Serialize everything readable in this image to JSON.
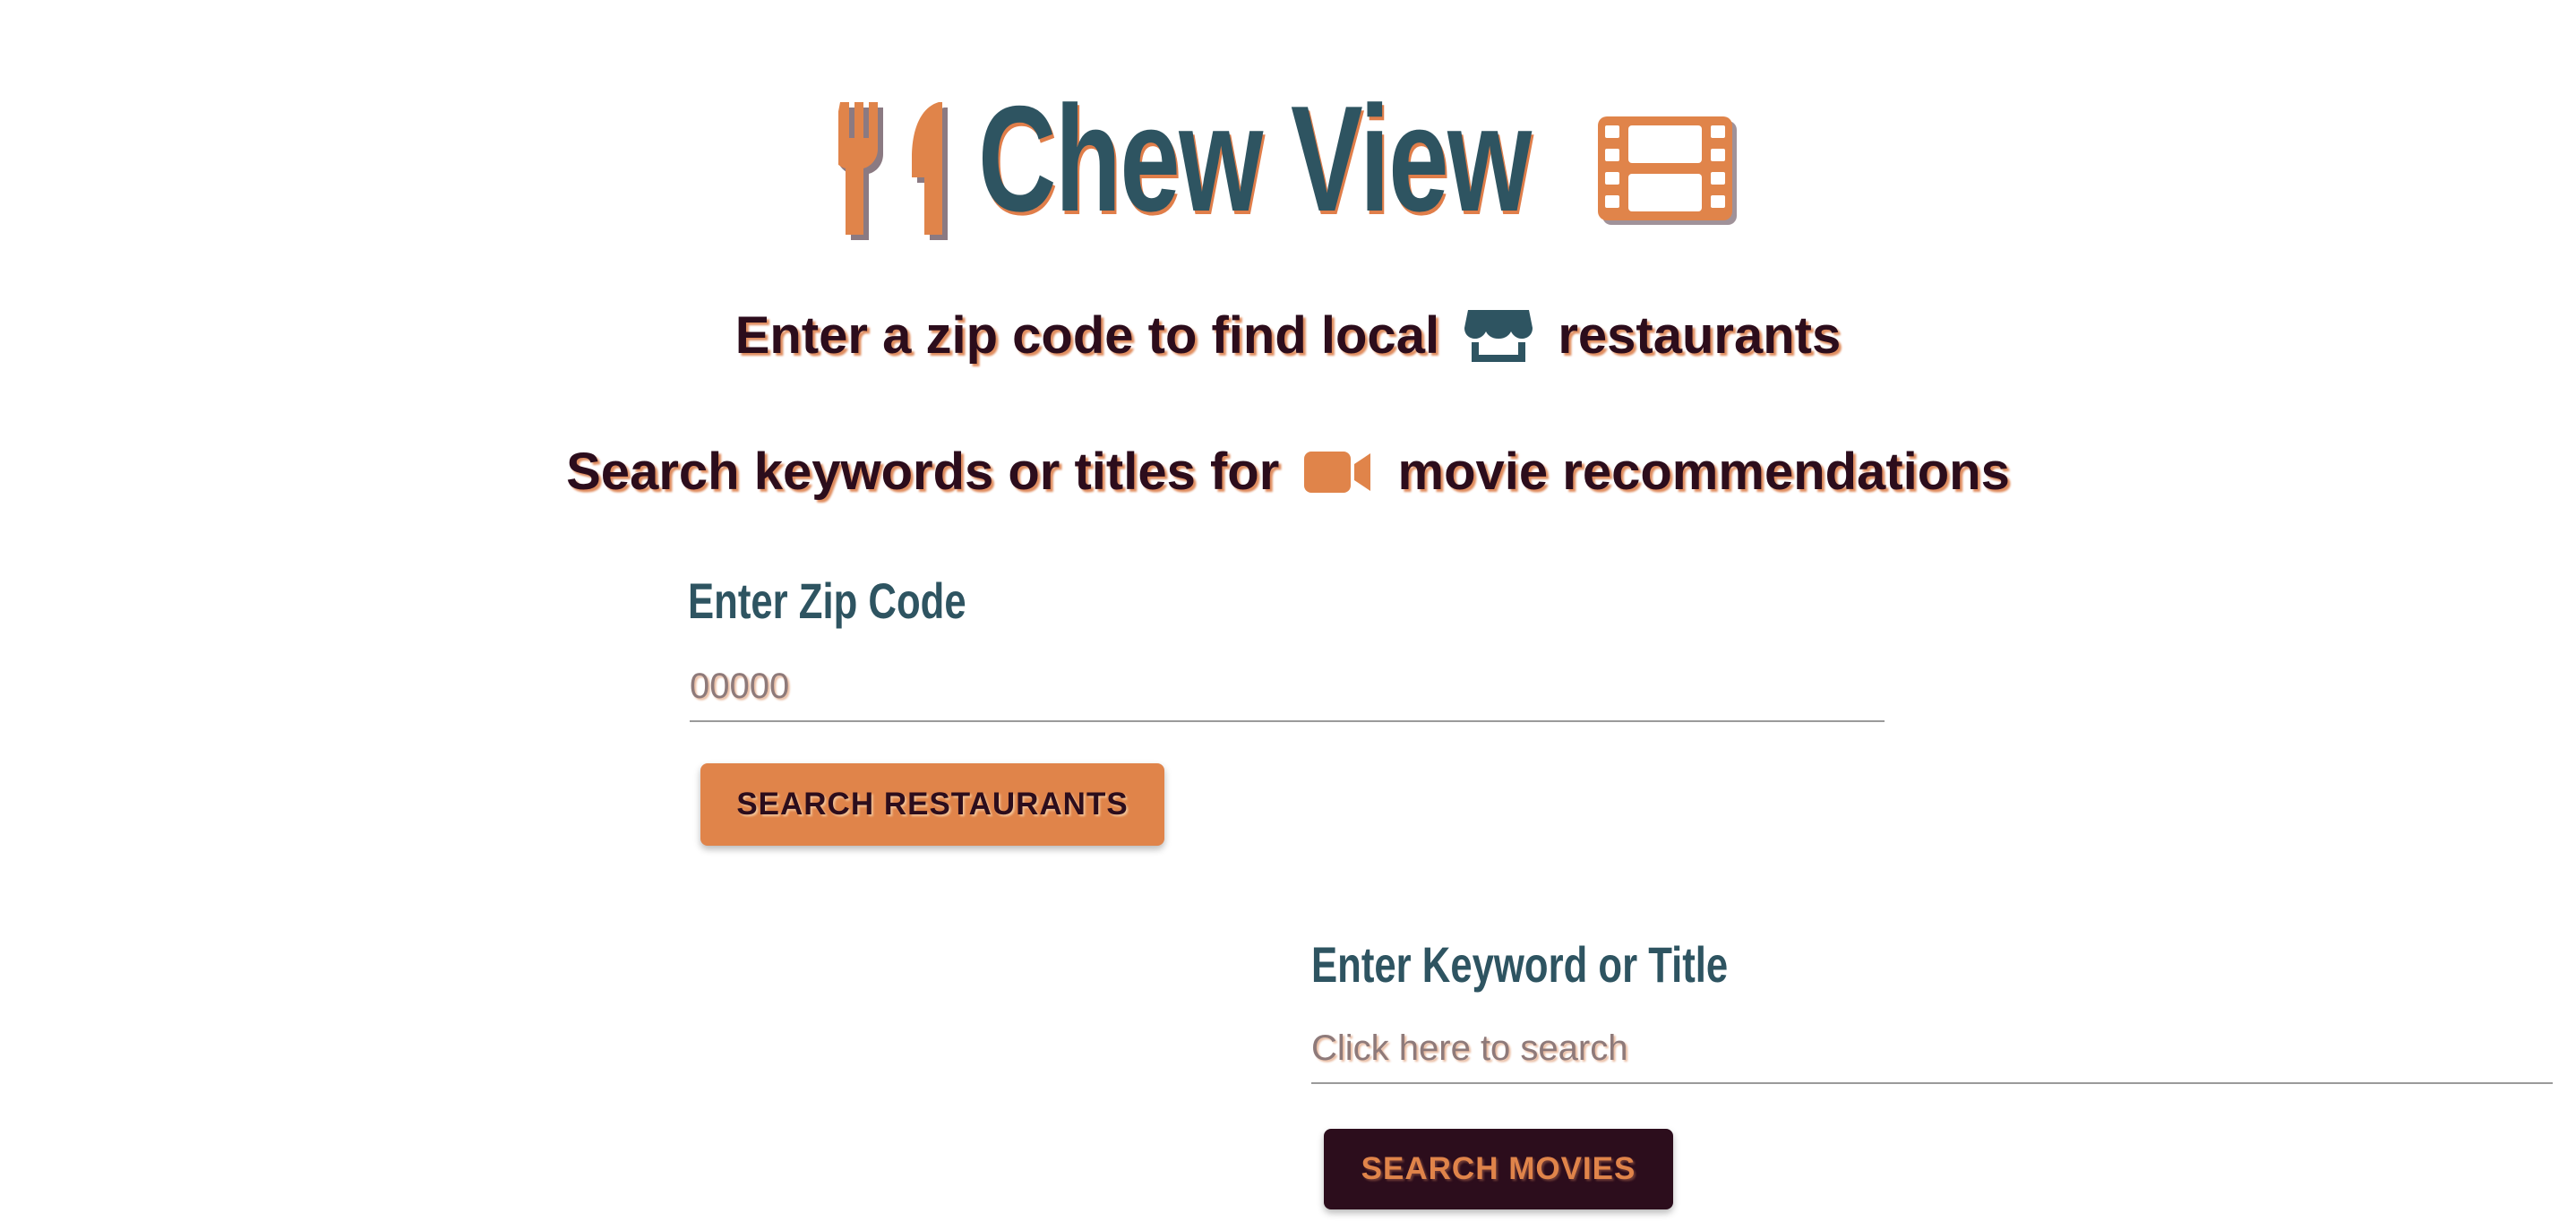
{
  "header": {
    "title": "Chew View",
    "left_icon": "utensils-icon",
    "right_icon": "film-icon"
  },
  "taglines": {
    "restaurants_before": "Enter a zip code to find local",
    "restaurants_icon": "store-icon",
    "restaurants_after": "restaurants",
    "movies_before": "Search keywords or titles for",
    "movies_icon": "video-camera-icon",
    "movies_after": "movie recommendations"
  },
  "zip_search": {
    "label": "Enter Zip Code",
    "placeholder": "00000",
    "value": "",
    "button_label": "Search Restaurants"
  },
  "movie_search": {
    "label": "Enter Keyword or Title",
    "placeholder": "Click here to search",
    "value": "",
    "button_label": "Search Movies"
  },
  "colors": {
    "teal": "#2e5461",
    "orange": "#e0844a",
    "dark_plum": "#2c0d1c"
  }
}
